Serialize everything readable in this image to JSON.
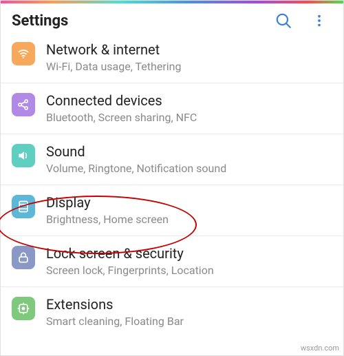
{
  "header": {
    "title": "Settings"
  },
  "items": [
    {
      "key": "network",
      "title": "Network & internet",
      "sub": "Wi-Fi, Data usage, Tethering",
      "color": "bg-orange",
      "icon": "wifi-icon"
    },
    {
      "key": "devices",
      "title": "Connected devices",
      "sub": "Bluetooth, Screen sharing, NFC",
      "color": "bg-purple",
      "icon": "share-icon"
    },
    {
      "key": "sound",
      "title": "Sound",
      "sub": "Volume, Ringtone, Notification sound",
      "color": "bg-teal",
      "icon": "speaker-icon"
    },
    {
      "key": "display",
      "title": "Display",
      "sub": "Brightness, Home screen",
      "color": "bg-cyan",
      "icon": "display-icon"
    },
    {
      "key": "lock",
      "title": "Lock screen & security",
      "sub": "Screen lock, Fingerprints, Location",
      "color": "bg-slate",
      "icon": "lock-icon"
    },
    {
      "key": "extensions",
      "title": "Extensions",
      "sub": "Smart cleaning, Floating Bar",
      "color": "bg-green",
      "icon": "extensions-icon"
    }
  ],
  "watermark": "wsxdn.com"
}
